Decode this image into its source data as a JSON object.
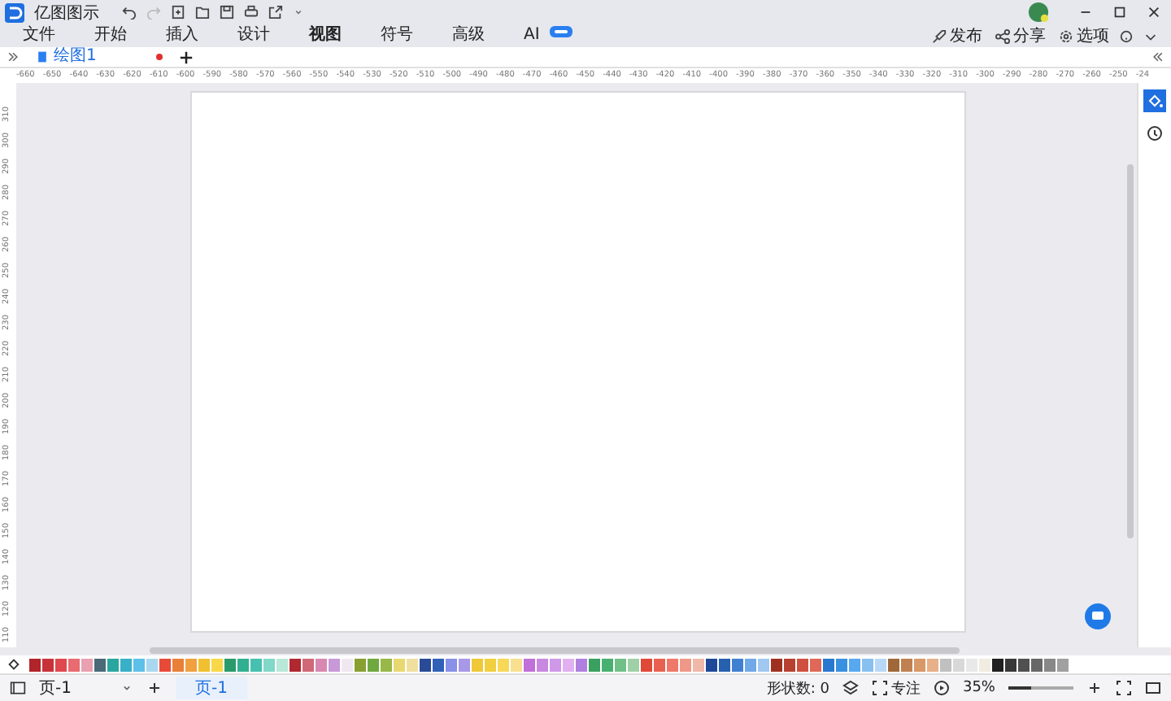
{
  "app": {
    "title": "亿图图示"
  },
  "menu": [
    {
      "label": "文件",
      "selected": false
    },
    {
      "label": "开始",
      "selected": false
    },
    {
      "label": "插入",
      "selected": false
    },
    {
      "label": "设计",
      "selected": false
    },
    {
      "label": "视图",
      "selected": true
    },
    {
      "label": "符号",
      "selected": false
    },
    {
      "label": "高级",
      "selected": false
    },
    {
      "label": "AI",
      "selected": false
    }
  ],
  "actions": [
    {
      "kind": "publish",
      "label": "发布"
    },
    {
      "kind": "share",
      "label": "分享"
    },
    {
      "kind": "options",
      "label": "选项"
    }
  ],
  "document_tabs": [
    {
      "label": "绘图1",
      "selected": true,
      "unsaved": true
    }
  ],
  "ruler": {
    "horizontal": [
      "-660",
      "-650",
      "-640",
      "-630",
      "-620",
      "-610",
      "-600",
      "-590",
      "-580",
      "-570",
      "-560",
      "-550",
      "-540",
      "-530",
      "-520",
      "-510",
      "-500",
      "-490",
      "-480",
      "-470",
      "-460",
      "-450",
      "-440",
      "-430",
      "-420",
      "-410",
      "-400",
      "-390",
      "-380",
      "-370",
      "-360",
      "-350",
      "-340",
      "-330",
      "-320",
      "-310",
      "-300",
      "-290",
      "-280",
      "-270",
      "-260",
      "-250",
      "-24"
    ],
    "vertical": [
      "310",
      "300",
      "290",
      "280",
      "270",
      "260",
      "250",
      "240",
      "230",
      "220",
      "210",
      "200",
      "190",
      "180",
      "170",
      "160",
      "150",
      "140",
      "130",
      "120",
      "110"
    ]
  },
  "palette": [
    {
      "color": "#b0242a"
    },
    {
      "color": "#c8323a"
    },
    {
      "color": "#e0484f"
    },
    {
      "color": "#e86b72"
    },
    {
      "color": "#e9a0b0"
    },
    {
      "color": "#4a6a78"
    },
    {
      "color": "#2aa6a0"
    },
    {
      "color": "#38b0c8"
    },
    {
      "color": "#5cc0e8"
    },
    {
      "color": "#a8d8f0"
    },
    {
      "color": "#e84a3a"
    },
    {
      "color": "#e8803a"
    },
    {
      "color": "#f0a040"
    },
    {
      "color": "#f0c030"
    },
    {
      "color": "#f8d848"
    },
    {
      "color": "#2a9a6a"
    },
    {
      "color": "#30b090"
    },
    {
      "color": "#48c0b0"
    },
    {
      "color": "#80d8c8"
    },
    {
      "color": "#b8e8d8"
    },
    {
      "color": "#b02830"
    },
    {
      "color": "#d06878"
    },
    {
      "color": "#d888b0"
    },
    {
      "color": "#c898d8"
    },
    {
      "color": "#f0e8f0"
    },
    {
      "color": "#88a030"
    },
    {
      "color": "#70a840"
    },
    {
      "color": "#98b848"
    },
    {
      "color": "#e8d870"
    },
    {
      "color": "#f0e0a0"
    },
    {
      "color": "#2a4a98"
    },
    {
      "color": "#3060b8"
    },
    {
      "color": "#8890e8"
    },
    {
      "color": "#a898e8"
    },
    {
      "color": "#f0c838"
    },
    {
      "color": "#f0d040"
    },
    {
      "color": "#f8d858"
    },
    {
      "color": "#f8e090"
    },
    {
      "color": "#c070d8"
    },
    {
      "color": "#c888e0"
    },
    {
      "color": "#d098e8"
    },
    {
      "color": "#e0b0f0"
    },
    {
      "color": "#b080e0"
    },
    {
      "color": "#3aa060"
    },
    {
      "color": "#48b070"
    },
    {
      "color": "#70c088"
    },
    {
      "color": "#a0d0a8"
    },
    {
      "color": "#e04838"
    },
    {
      "color": "#e86050"
    },
    {
      "color": "#f07868"
    },
    {
      "color": "#f09888"
    },
    {
      "color": "#f0b8a8"
    },
    {
      "color": "#204898"
    },
    {
      "color": "#2860b0"
    },
    {
      "color": "#4080d0"
    },
    {
      "color": "#70a8e8"
    },
    {
      "color": "#a0c8f0"
    },
    {
      "color": "#a03020"
    },
    {
      "color": "#b84030"
    },
    {
      "color": "#d05040"
    },
    {
      "color": "#e06858"
    },
    {
      "color": "#2878d0"
    },
    {
      "color": "#3890e0"
    },
    {
      "color": "#58a8f0"
    },
    {
      "color": "#88c0f0"
    },
    {
      "color": "#b8d8f8"
    },
    {
      "color": "#a06838"
    },
    {
      "color": "#c08050"
    },
    {
      "color": "#d89868"
    },
    {
      "color": "#e8b088"
    },
    {
      "color": "#c0c0c0"
    },
    {
      "color": "#d8d8d8"
    },
    {
      "color": "#e8e8e8"
    },
    {
      "color": "#f0ece0"
    },
    {
      "color": "#202020"
    },
    {
      "color": "#383838"
    },
    {
      "color": "#505050"
    },
    {
      "color": "#686868"
    },
    {
      "color": "#888888"
    },
    {
      "color": "#a0a0a0"
    }
  ],
  "status": {
    "page_select": "页-1",
    "page_tabs": [
      {
        "label": "页-1",
        "selected": true
      }
    ],
    "shape_count": "形状数: 0",
    "focus": "专注",
    "zoom": "35%",
    "zoom_slider": {
      "level": 0.35
    }
  }
}
